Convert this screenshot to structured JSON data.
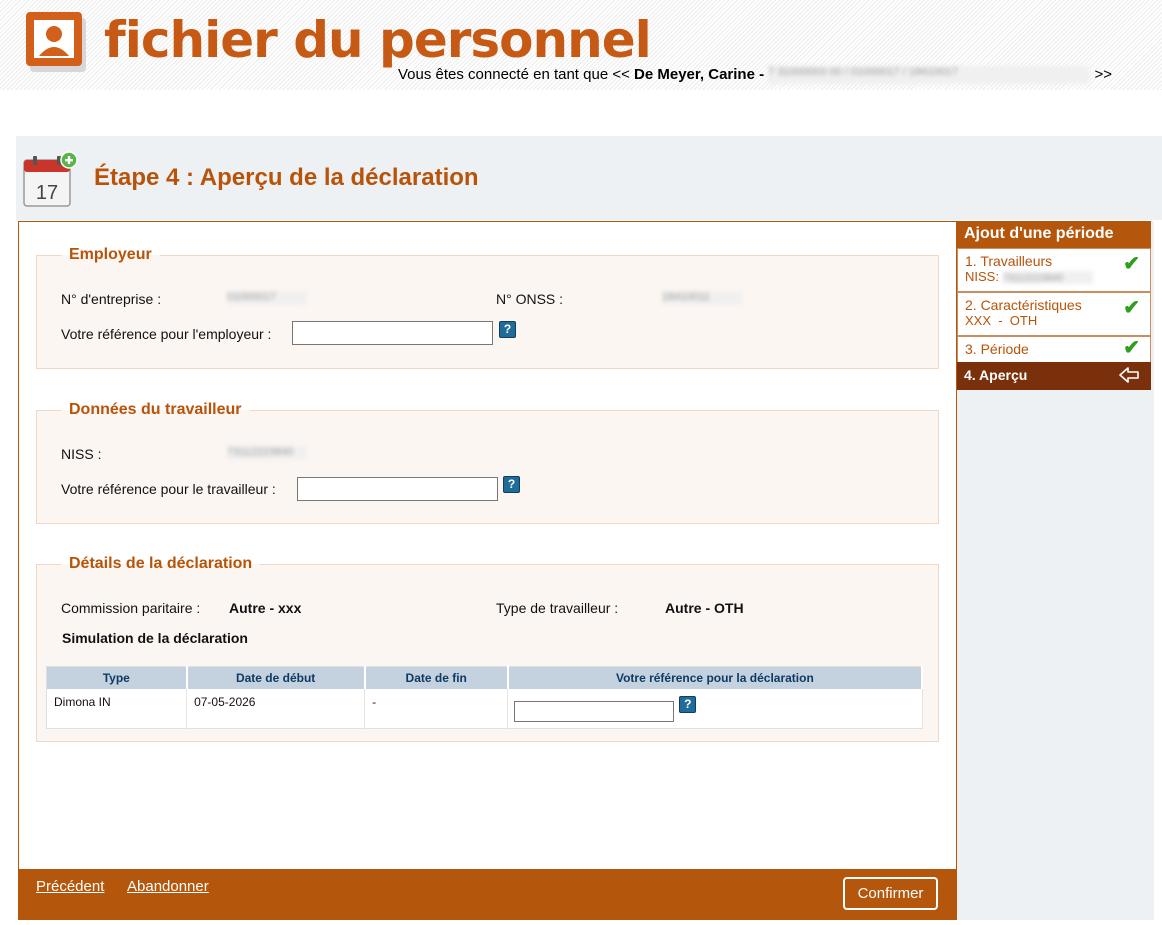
{
  "header": {
    "logo_title": "fichier du personnel",
    "connected_prefix": "Vous êtes connecté en tant que <<",
    "user_name": "De Meyer, Carine -",
    "user_identifiers": "7 31000003 00 / 01000017 / 18410017",
    "connected_suffix": ">>"
  },
  "page": {
    "calendar_day": "17",
    "title": "Étape 4 : Aperçu de la déclaration"
  },
  "employer": {
    "legend": "Employeur",
    "enterprise_label": "N° d'entreprise :",
    "enterprise_value": "01000017",
    "onss_label": "N° ONSS :",
    "onss_value": "18410011",
    "reference_label": "Votre référence pour l'employeur :",
    "reference_value": ""
  },
  "worker": {
    "legend": "Données du travailleur",
    "niss_label": "NISS :",
    "niss_value": "73112223840",
    "reference_label": "Votre référence pour le travailleur :",
    "reference_value": ""
  },
  "details": {
    "legend": "Détails de la déclaration",
    "commission_label": "Commission paritaire :",
    "commission_value": "Autre - xxx",
    "worker_type_label": "Type de travailleur :",
    "worker_type_value": "Autre - OTH",
    "simulation_title": "Simulation de la déclaration",
    "table": {
      "headers": [
        "Type",
        "Date de début",
        "Date de fin",
        "Votre référence pour la déclaration"
      ],
      "rows": [
        {
          "type": "Dimona IN",
          "start": "07-05-2026",
          "end": "-",
          "reference": ""
        }
      ]
    }
  },
  "footer": {
    "previous_label": "Précédent",
    "abandon_label": "Abandonner",
    "confirm_label": "Confirmer"
  },
  "sidebar": {
    "title": "Ajout d'une période",
    "steps": [
      {
        "label": "1. Travailleurs",
        "sub_label": "NISS:",
        "sub_value": "73112223840",
        "done": true
      },
      {
        "label": "2. Caractéristiques",
        "sub_label": "XXX  -  OTH",
        "done": true
      },
      {
        "label": "3. Période",
        "done": true
      },
      {
        "label": "4. Aperçu",
        "active": true
      }
    ]
  },
  "help_glyph": "?",
  "check_glyph": "✔",
  "colors": {
    "brand_orange": "#b4560c",
    "title_orange": "#b85309",
    "active_step": "#7a300a",
    "check_green": "#2f9e1e",
    "table_header": "#c4d1de"
  },
  "icons": {
    "logo": "person-icon",
    "calendar": "calendar-add-icon",
    "help": "help-icon",
    "check": "check-icon",
    "current_step": "arrow-left-icon"
  }
}
